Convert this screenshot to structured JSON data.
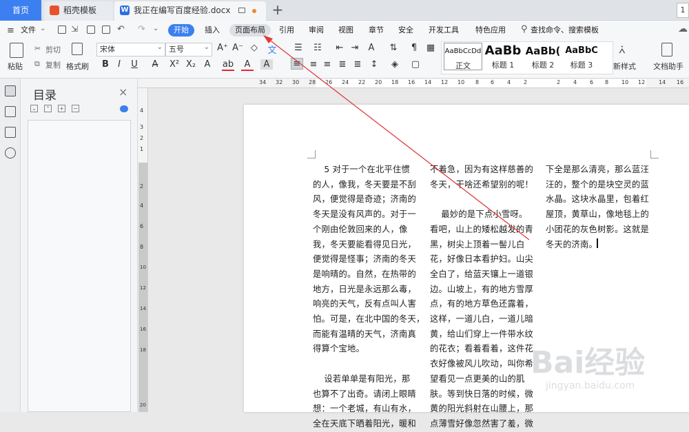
{
  "tabs": {
    "home": "首页",
    "templates": "稻壳模板",
    "document": "我正在编写百度经验.docx",
    "page_indicator": "1"
  },
  "menubar": {
    "file": "文件",
    "items": [
      "开始",
      "插入",
      "页面布局",
      "引用",
      "审阅",
      "视图",
      "章节",
      "安全",
      "开发工具",
      "特色应用"
    ],
    "search": "查找命令、搜索模板",
    "active": "开始",
    "highlighted": "页面布局"
  },
  "ribbon": {
    "paste": "粘贴",
    "cut": "剪切",
    "copy": "复制",
    "format_painter": "格式刷",
    "font_name": "宋体",
    "font_size": "五号",
    "styles": [
      {
        "sample": "AaBbCcDd",
        "name": "正文"
      },
      {
        "sample": "AaBb",
        "name": "标题 1"
      },
      {
        "sample": "AaBb(",
        "name": "标题 2"
      },
      {
        "sample": "AaBbC",
        "name": "标题 3"
      }
    ],
    "new_style": "新样式",
    "doc_assistant": "文档助手"
  },
  "toc": {
    "title": "目录"
  },
  "ruler": {
    "h_numbers": [
      "34",
      "32",
      "30",
      "28",
      "26",
      "24",
      "22",
      "20",
      "18",
      "16",
      "14",
      "12",
      "10",
      "8",
      "6",
      "4",
      "2",
      "2",
      "4",
      "6",
      "8",
      "10",
      "12",
      "14",
      "16"
    ],
    "v_numbers": [
      "4",
      "3",
      "2",
      "1",
      "2",
      "4",
      "6",
      "8",
      "10",
      "12",
      "14",
      "16",
      "18",
      "20"
    ]
  },
  "document": {
    "col1": "    5 对于一个在北平住惯\n的人，像我，冬天要是不刮\n风，便觉得是奇迹；济南的\n冬天是没有风声的。对于一\n个刚由伦敦回来的人，像\n我，冬天要能看得见日光，\n便觉得是怪事；济南的冬天\n是响晴的。自然，在热带的\n地方，日光是永远那么毒，\n响亮的天气，反有点叫人害\n怕。可是，在北中国的冬天，\n而能有温晴的天气，济南真\n得算个宝地。\n\n    设若单单是有阳光，那\n也算不了出奇。请闭上眼睛\n想：一个老城，有山有水，\n全在天底下晒着阳光，暖和",
    "col2": "不着急，因为有这样慈善的\n冬天，干啥还希望别的呢！\n\n    最妙的是下点小雪呀。\n看吧，山上的矮松越发的青\n黑，树尖上顶着一髻儿白\n花，好像日本看护妇。山尖\n全白了，给蓝天镶上一道银\n边。山坡上，有的地方雪厚\n点，有的地方草色还露着，\n这样，一道儿白，一道儿暗\n黄，给山们穿上一件带水纹\n的花衣；看着看着，这件花\n衣好像被风儿吹动，叫你希\n望看见一点更美的山的肌\n肤。等到快日落的时候，微\n黄的阳光斜射在山腰上，那\n点薄雪好像忽然害了羞，微",
    "col3": "下全是那么清亮，那么蓝汪\n汪的，整个的是块空灵的蓝\n水晶。这块水晶里，包着红\n屋顶，黄草山，像地毯上的\n小团花的灰色树影。这就是\n冬天的济南。"
  },
  "watermark": {
    "text": "Bai经验",
    "url": "jingyan.baidu.com"
  }
}
